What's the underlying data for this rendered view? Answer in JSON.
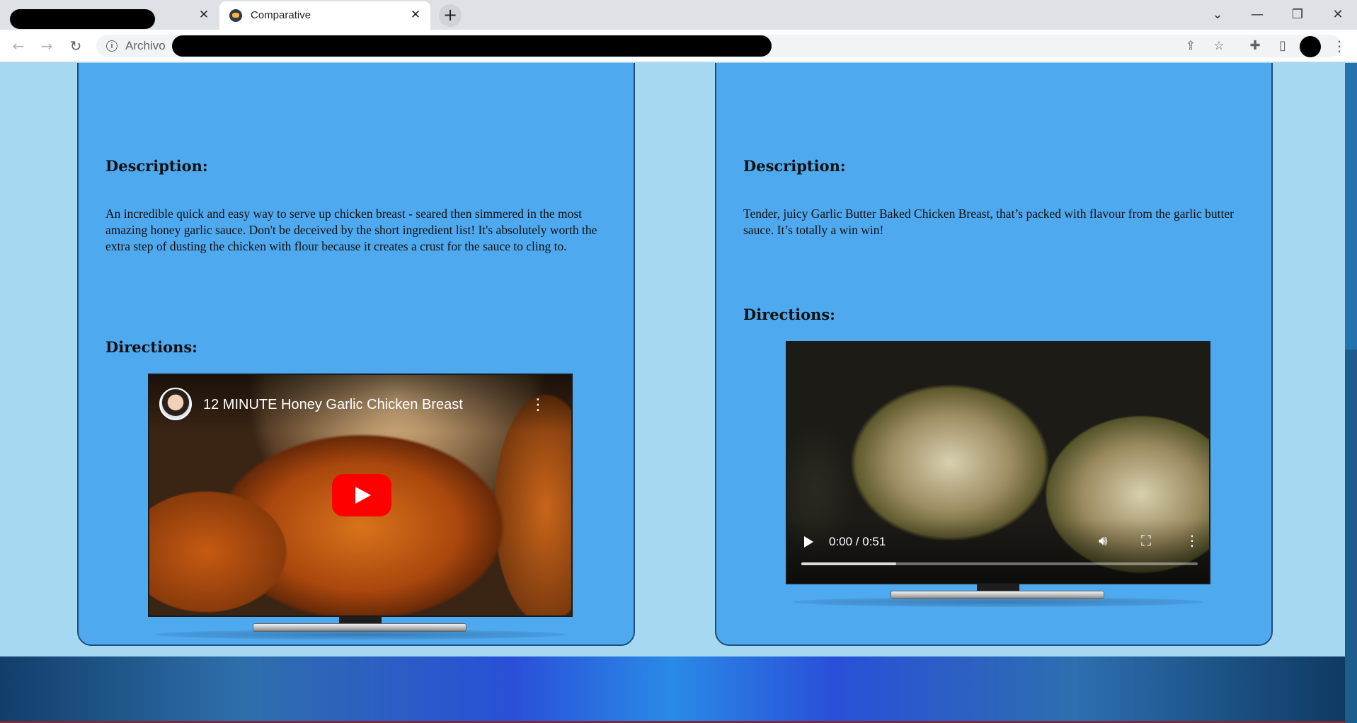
{
  "browser": {
    "active_tab_title": "Comparative",
    "tab_close_glyph": "✕",
    "new_tab_glyph": "+",
    "address_label": "Archivo",
    "window_controls": [
      "⌄",
      "—",
      "❐",
      "✕"
    ]
  },
  "left_card": {
    "description_heading": "Description:",
    "description_text": "An incredible quick and easy way to serve up chicken breast - seared then simmered in the most amazing honey garlic sauce. Don't be deceived by the short ingredient list! It's absolutely worth the extra step of dusting the chicken with flour because it creates a crust for the sauce to cling to.",
    "directions_heading": "Directions:",
    "video": {
      "title": "12 MINUTE Honey Garlic Chicken Breast",
      "type": "youtube-embed"
    }
  },
  "right_card": {
    "description_heading": "Description:",
    "description_text": "Tender, juicy Garlic Butter Baked Chicken Breast, that’s packed with flavour from the garlic butter sauce. It’s totally a win win!",
    "directions_heading": "Directions:",
    "video": {
      "type": "html5-video",
      "time": "0:00 / 0:51",
      "buffered_fraction": 0.24
    }
  },
  "colors": {
    "page_background": "#a6d8ef",
    "card_background": "#4fa9ef",
    "card_border": "#1c4e7a",
    "youtube_red": "#ff0000"
  },
  "icons": {
    "back": "back-arrow-icon",
    "forward": "forward-arrow-icon",
    "reload": "reload-icon",
    "info": "info-icon",
    "share": "share-icon",
    "bookmark": "star-icon",
    "extensions": "puzzle-icon",
    "side_panel": "side-panel-icon",
    "volume": "volume-icon",
    "fullscreen": "fullscreen-icon",
    "more": "more-vert-icon"
  }
}
